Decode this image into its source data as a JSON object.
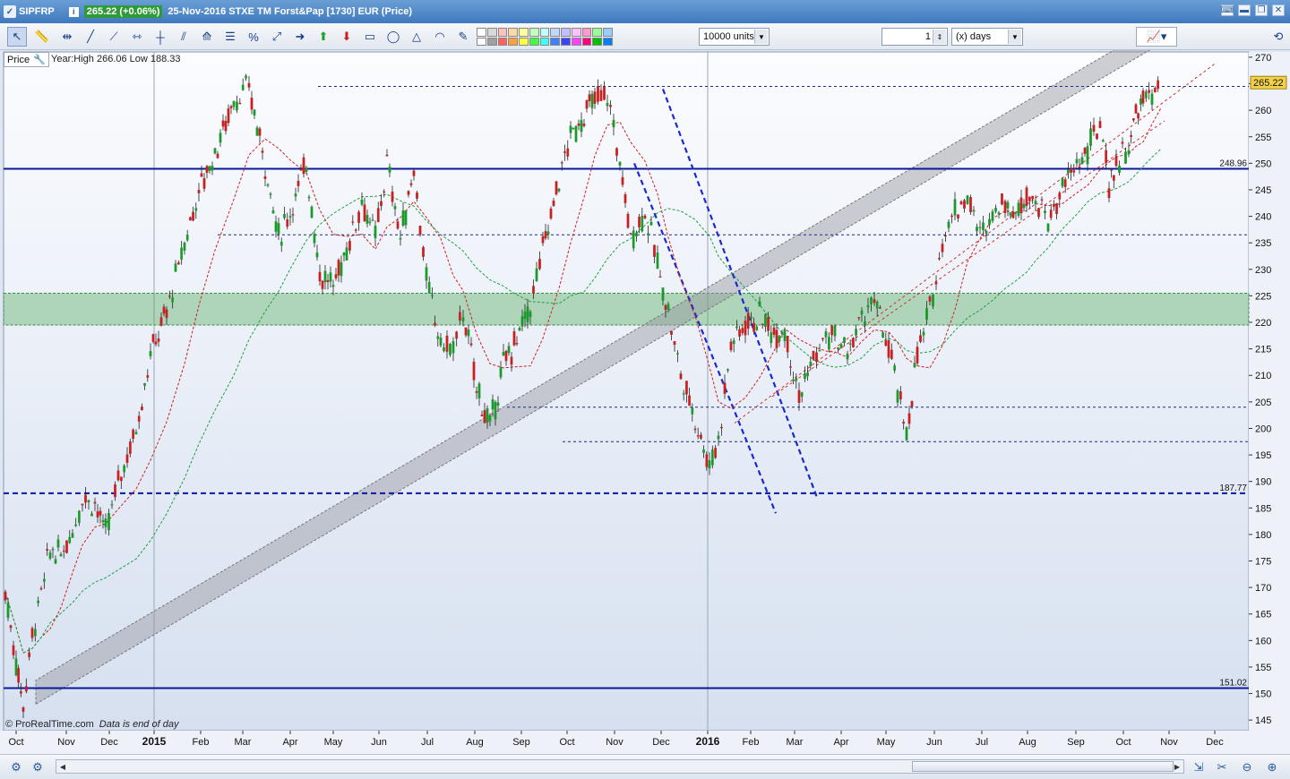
{
  "window": {
    "symbol": "SIPFRP",
    "last_price": "265.22 (+0.06%)",
    "description": "25-Nov-2016 STXE TM Forst&Pap [1730] EUR (Price)"
  },
  "toolbar": {
    "units_value": "10000 units",
    "period_value": "1",
    "period_unit": "(x) days",
    "palette_colors": [
      "#ffffff",
      "#d9d9d9",
      "#ffc0c0",
      "#ffd8a8",
      "#ffff99",
      "#c0ffc0",
      "#c0ffff",
      "#c0d8ff",
      "#c0c0ff",
      "#ffc0ff",
      "#ff99cc",
      "#99ff99",
      "#99ccff",
      "#ffffff",
      "#a0a0a0",
      "#ff6060",
      "#ffa040",
      "#ffff40",
      "#40ff40",
      "#40ffff",
      "#4080ff",
      "#4040ff",
      "#ff40ff",
      "#ff0080",
      "#00c000",
      "#0080ff"
    ]
  },
  "chart": {
    "price_label": "Price",
    "year_high_low": "Year:High 266.06 Low 188.33",
    "credit": "© ProRealTime.com",
    "credit_note": "Data is end of day"
  },
  "chart_data": {
    "type": "candlestick",
    "title": "25-Nov-2016 STXE TM Forst&Pap [1730] EUR (Price)",
    "ylim": [
      143,
      271
    ],
    "y_ticks": [
      145,
      150,
      155,
      160,
      165,
      170,
      175,
      180,
      185,
      190,
      195,
      200,
      205,
      210,
      215,
      220,
      225,
      230,
      235,
      240,
      245,
      250,
      255,
      260,
      265,
      270
    ],
    "x_tick_labels": [
      "Oct",
      "Nov",
      "Dec",
      "2015",
      "Feb",
      "Mar",
      "Apr",
      "May",
      "Jun",
      "Jul",
      "Aug",
      "Sep",
      "Oct",
      "Nov",
      "Dec",
      "2016",
      "Feb",
      "Mar",
      "Apr",
      "May",
      "Jun",
      "Jul",
      "Aug",
      "Sep",
      "Oct",
      "Nov",
      "Dec"
    ],
    "x_bold_labels": [
      "2015",
      "2016"
    ],
    "current_price": 265.22,
    "horizontal_levels": [
      {
        "value": 248.96,
        "label": "248.96",
        "style": "solid"
      },
      {
        "value": 187.77,
        "label": "187.77",
        "style": "dashed"
      },
      {
        "value": 151.02,
        "label": "151.02",
        "style": "solid"
      }
    ],
    "dashed_levels": [
      264.5,
      236.5,
      204,
      197.5
    ],
    "support_zone": [
      219.5,
      225.5
    ],
    "price_path": [
      [
        0,
        169
      ],
      [
        12,
        156
      ],
      [
        20,
        148
      ],
      [
        30,
        161
      ],
      [
        40,
        169
      ],
      [
        50,
        177
      ],
      [
        62,
        176
      ],
      [
        75,
        181
      ],
      [
        86,
        187
      ],
      [
        100,
        186
      ],
      [
        112,
        180
      ],
      [
        126,
        190
      ],
      [
        146,
        200
      ],
      [
        162,
        214
      ],
      [
        180,
        222
      ],
      [
        200,
        235
      ],
      [
        216,
        245
      ],
      [
        234,
        252
      ],
      [
        255,
        262
      ],
      [
        272,
        264
      ],
      [
        290,
        250
      ],
      [
        305,
        236
      ],
      [
        318,
        241
      ],
      [
        336,
        250
      ],
      [
        351,
        229
      ],
      [
        366,
        227
      ],
      [
        381,
        234
      ],
      [
        398,
        243
      ],
      [
        413,
        236
      ],
      [
        426,
        250
      ],
      [
        441,
        236
      ],
      [
        456,
        249
      ],
      [
        470,
        228
      ],
      [
        486,
        216
      ],
      [
        500,
        215
      ],
      [
        511,
        222
      ],
      [
        526,
        208
      ],
      [
        541,
        200
      ],
      [
        556,
        212
      ],
      [
        568,
        216
      ],
      [
        586,
        223
      ],
      [
        600,
        234
      ],
      [
        618,
        247
      ],
      [
        631,
        255
      ],
      [
        646,
        259
      ],
      [
        658,
        262
      ],
      [
        672,
        263
      ],
      [
        686,
        250
      ],
      [
        698,
        236
      ],
      [
        714,
        241
      ],
      [
        728,
        231
      ],
      [
        740,
        222
      ],
      [
        754,
        210
      ],
      [
        770,
        202
      ],
      [
        786,
        193
      ],
      [
        796,
        198
      ],
      [
        810,
        216
      ],
      [
        826,
        220
      ],
      [
        842,
        221
      ],
      [
        858,
        218
      ],
      [
        870,
        219
      ],
      [
        886,
        206
      ],
      [
        902,
        213
      ],
      [
        916,
        217
      ],
      [
        926,
        217
      ],
      [
        940,
        214
      ],
      [
        956,
        221
      ],
      [
        970,
        224
      ],
      [
        986,
        215
      ],
      [
        996,
        207
      ],
      [
        1006,
        199
      ],
      [
        1018,
        214
      ],
      [
        1032,
        222
      ],
      [
        1046,
        236
      ],
      [
        1060,
        241
      ],
      [
        1074,
        244
      ],
      [
        1088,
        236
      ],
      [
        1102,
        241
      ],
      [
        1116,
        243
      ],
      [
        1128,
        240
      ],
      [
        1140,
        245
      ],
      [
        1150,
        243
      ],
      [
        1164,
        239
      ],
      [
        1180,
        245
      ],
      [
        1196,
        250
      ],
      [
        1208,
        252
      ],
      [
        1222,
        258
      ],
      [
        1232,
        246
      ],
      [
        1240,
        250
      ],
      [
        1254,
        253
      ],
      [
        1262,
        259
      ],
      [
        1270,
        262
      ],
      [
        1280,
        263
      ],
      [
        1290,
        265.22
      ]
    ]
  }
}
